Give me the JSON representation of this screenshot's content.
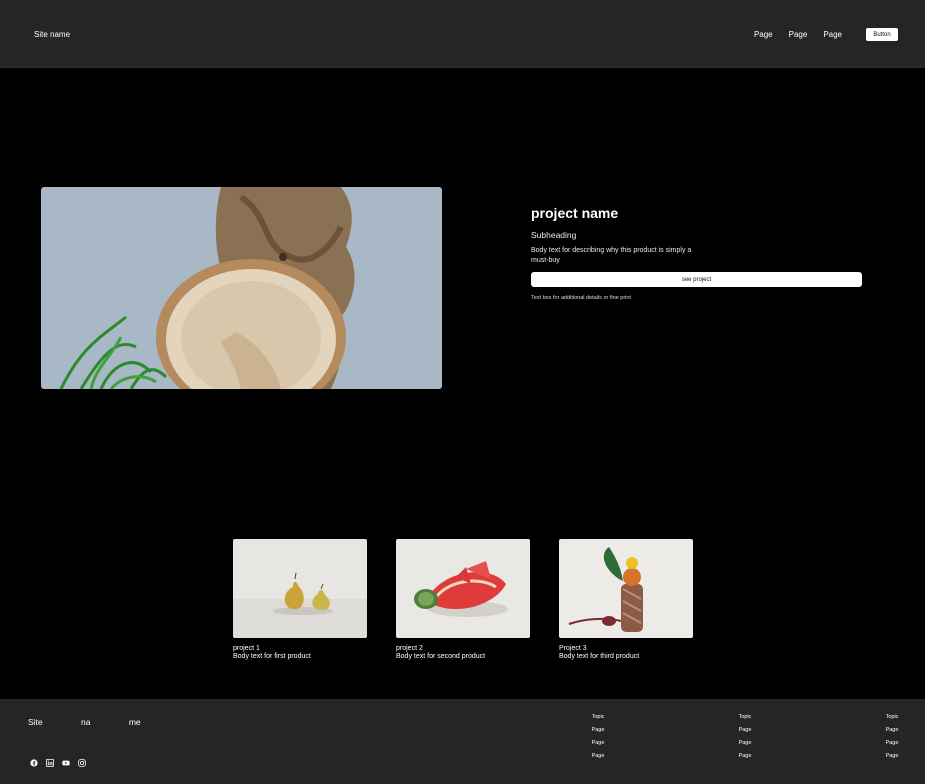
{
  "header": {
    "site_name": "Site name",
    "nav": [
      "Page",
      "Page",
      "Page"
    ],
    "button_label": "Button"
  },
  "hero": {
    "title": "project name",
    "subheading": "Subheading",
    "body": "Body text for describing why this product is simply a must-buy",
    "button_label": "see project",
    "fine_print": "Text box for additional details or fine print"
  },
  "projects": [
    {
      "title": "project 1",
      "body": "Body text for first product"
    },
    {
      "title": "project 2",
      "body": "Body text for second product"
    },
    {
      "title": "Project 3",
      "body": "Body text for third product"
    }
  ],
  "footer": {
    "site_name": "Site na me",
    "social_icons": [
      "facebook-icon",
      "linkedin-icon",
      "youtube-icon",
      "instagram-icon"
    ],
    "columns": [
      {
        "topic": "Topic",
        "pages": [
          "Page",
          "Page",
          "Page"
        ]
      },
      {
        "topic": "Topic",
        "pages": [
          "Page",
          "Page",
          "Page"
        ]
      },
      {
        "topic": "Topic",
        "pages": [
          "Page",
          "Page",
          "Page"
        ]
      }
    ]
  },
  "colors": {
    "header_bg": "#252525",
    "page_bg": "#000000",
    "button_bg": "#ffffff"
  }
}
